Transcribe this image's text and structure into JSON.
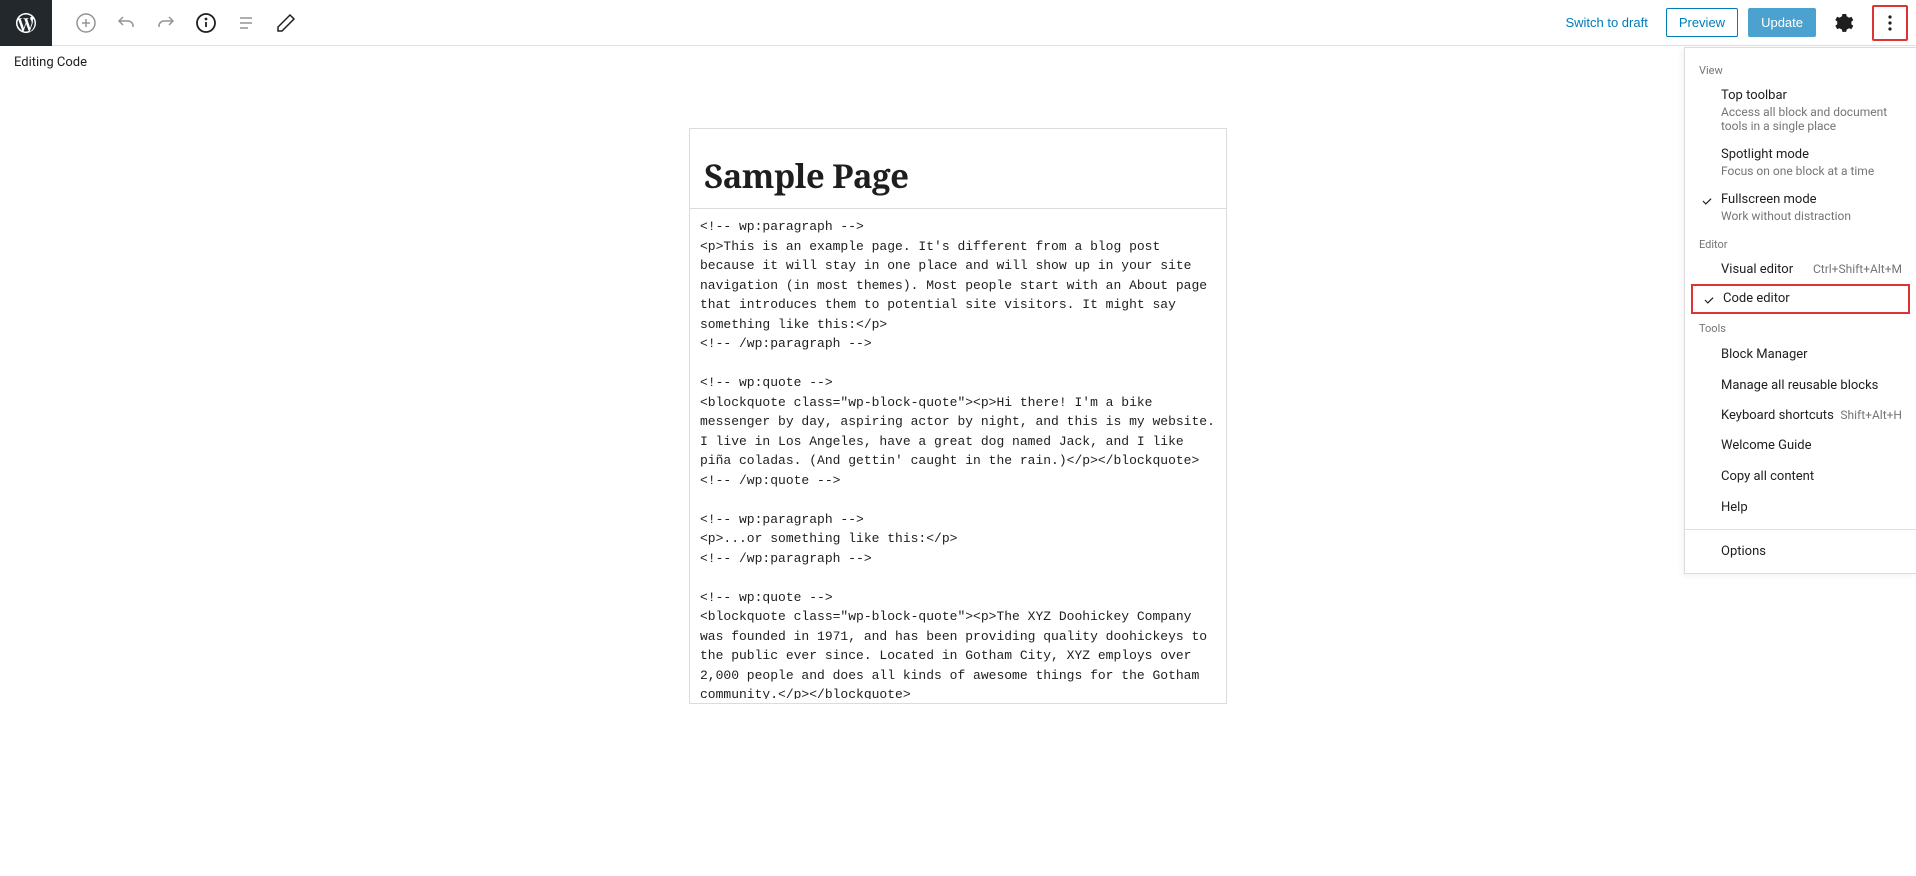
{
  "topbar": {
    "switch_draft": "Switch to draft",
    "preview": "Preview",
    "update": "Update"
  },
  "subbar": {
    "label": "Editing Code"
  },
  "editor": {
    "title": "Sample Page",
    "code": "<!-- wp:paragraph -->\n<p>This is an example page. It's different from a blog post because it will stay in one place and will show up in your site navigation (in most themes). Most people start with an About page that introduces them to potential site visitors. It might say something like this:</p>\n<!-- /wp:paragraph -->\n\n<!-- wp:quote -->\n<blockquote class=\"wp-block-quote\"><p>Hi there! I'm a bike messenger by day, aspiring actor by night, and this is my website. I live in Los Angeles, have a great dog named Jack, and I like piña coladas. (And gettin' caught in the rain.)</p></blockquote>\n<!-- /wp:quote -->\n\n<!-- wp:paragraph -->\n<p>...or something like this:</p>\n<!-- /wp:paragraph -->\n\n<!-- wp:quote -->\n<blockquote class=\"wp-block-quote\"><p>The XYZ Doohickey Company was founded in 1971, and has been providing quality doohickeys to the public ever since. Located in Gotham City, XYZ employs over 2,000 people and does all kinds of awesome things for the Gotham community.</p></blockquote>\n<!-- /wp:quote -->"
  },
  "dropdown": {
    "view_label": "View",
    "top_toolbar": {
      "title": "Top toolbar",
      "desc": "Access all block and document tools in a single place"
    },
    "spotlight": {
      "title": "Spotlight mode",
      "desc": "Focus on one block at a time"
    },
    "fullscreen": {
      "title": "Fullscreen mode",
      "desc": "Work without distraction"
    },
    "editor_label": "Editor",
    "visual": {
      "title": "Visual editor",
      "shortcut": "Ctrl+Shift+Alt+M"
    },
    "code": {
      "title": "Code editor"
    },
    "tools_label": "Tools",
    "block_manager": "Block Manager",
    "reusable": "Manage all reusable blocks",
    "keyboard": {
      "title": "Keyboard shortcuts",
      "shortcut": "Shift+Alt+H"
    },
    "welcome": "Welcome Guide",
    "copy_all": "Copy all content",
    "help": "Help",
    "options": "Options"
  }
}
